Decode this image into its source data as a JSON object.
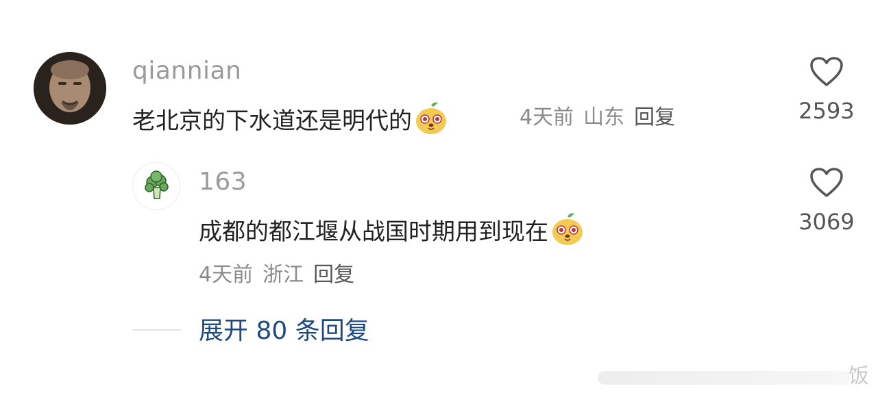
{
  "comments": [
    {
      "username": "qiannian",
      "text": "老北京的下水道还是明代的",
      "emoji": "pear-smile-emoji",
      "time": "4天前",
      "location": "山东",
      "reply_label": "回复",
      "likes": "2593",
      "avatar": "man-portrait-avatar"
    },
    {
      "username": "163",
      "text": "成都的都江堰从战国时期用到现在",
      "emoji": "pear-smile-emoji",
      "time": "4天前",
      "location": "浙江",
      "reply_label": "回复",
      "likes": "3069",
      "avatar": "broccoli-avatar"
    }
  ],
  "expand_replies": "展开 80 条回复",
  "watermark": "饭",
  "colors": {
    "username": "#9a9a9a",
    "text": "#222222",
    "meta": "#8a8a8a",
    "link": "#1f4a80",
    "heart": "#555555"
  }
}
